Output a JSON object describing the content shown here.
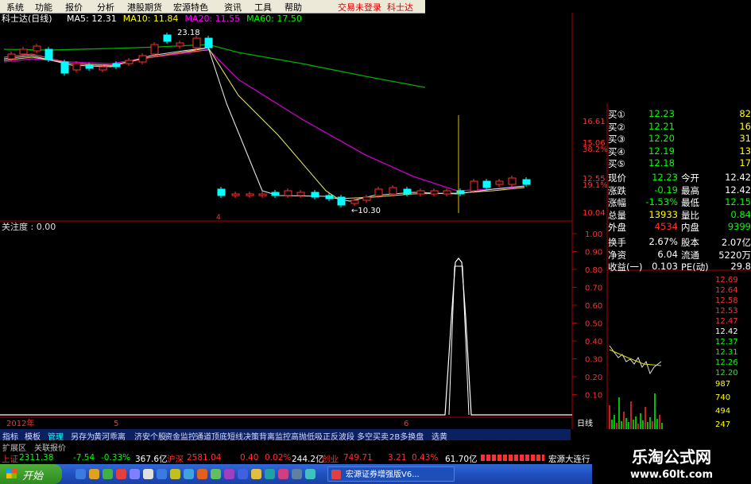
{
  "menu": {
    "items": [
      "系统",
      "功能",
      "报价",
      "分析",
      "港股期货",
      "宏源特色",
      "资讯",
      "工具",
      "帮助"
    ],
    "trade_login": "交易未登录",
    "stock_short": "科士达"
  },
  "chart": {
    "title": "科士达(日线)",
    "ma_labels": [
      {
        "text": "MA5: 12.31",
        "color": "#ffffff"
      },
      {
        "text": "MA10: 11.84",
        "color": "#ffff00"
      },
      {
        "text": "MA20: 11.55",
        "color": "#ff00ff"
      },
      {
        "text": "MA60: 17.50",
        "color": "#00ff00"
      }
    ],
    "high_label": "23.18",
    "low_label": "10.30",
    "price_axis": [
      "16.61",
      "15.06",
      "38.2%",
      "12.55",
      "19.1%",
      "10.04"
    ],
    "indicator_title": "关注度 : 0.00",
    "indicator_axis": [
      "1.00",
      "0.90",
      "0.80",
      "0.70",
      "0.60",
      "0.50",
      "0.40",
      "0.30",
      "0.20",
      "0.10"
    ],
    "time_labels": [
      "2012年",
      "5",
      "6"
    ],
    "marker_4": "4",
    "colors": {
      "up": "#ff3030",
      "down": "#00ffff",
      "ma60": "#00cc00",
      "ma20": "#cc00cc",
      "ma10": "#e0e060",
      "axis": "#b00000"
    }
  },
  "quote": {
    "book": [
      {
        "label": "买①",
        "price": "12.23",
        "vol": "82"
      },
      {
        "label": "买②",
        "price": "12.21",
        "vol": "16"
      },
      {
        "label": "买③",
        "price": "12.20",
        "vol": "31"
      },
      {
        "label": "买④",
        "price": "12.19",
        "vol": "13"
      },
      {
        "label": "买⑤",
        "price": "12.18",
        "vol": "17"
      }
    ],
    "stats": [
      {
        "l1": "现价",
        "v1": "12.23",
        "c1": "#00ff00",
        "l2": "今开",
        "v2": "12.42",
        "c2": "#ffffff"
      },
      {
        "l1": "涨跌",
        "v1": "-0.19",
        "c1": "#00ff00",
        "l2": "最高",
        "v2": "12.42",
        "c2": "#ffffff"
      },
      {
        "l1": "涨幅",
        "v1": "-1.53%",
        "c1": "#00ff00",
        "l2": "最低",
        "v2": "12.15",
        "c2": "#00ff00"
      },
      {
        "l1": "总量",
        "v1": "13933",
        "c1": "#ffff00",
        "l2": "量比",
        "v2": "0.84",
        "c2": "#00ff00"
      },
      {
        "l1": "外盘",
        "v1": "4534",
        "c1": "#ff3030",
        "l2": "内盘",
        "v2": "9399",
        "c2": "#00ff00"
      },
      {
        "l1": "换手",
        "v1": "2.67%",
        "c1": "#ffffff",
        "l2": "股本",
        "v2": "2.07亿",
        "c2": "#ffffff"
      },
      {
        "l1": "净资",
        "v1": "6.04",
        "c1": "#ffffff",
        "l2": "流通",
        "v2": "5220万",
        "c2": "#ffffff"
      },
      {
        "l1": "收益(一)",
        "v1": "0.103",
        "c1": "#ffffff",
        "l2": "PE(动)",
        "v2": "29.8",
        "c2": "#ffffff"
      }
    ],
    "mini_axis": [
      "12.69",
      "12.64",
      "12.58",
      "12.53",
      "12.47",
      "12.42",
      "12.37",
      "12.31",
      "12.26",
      "12.20"
    ],
    "mini_vol_axis": [
      "987",
      "740",
      "494",
      "247"
    ],
    "period": "日线"
  },
  "tabs": {
    "row1": [
      "指标",
      "模板",
      "管理",
      "另存为",
      "黄河乖离",
      "济安个股",
      "资金监控",
      "通道顶底",
      "短线决策",
      "背离监控",
      "高抛低吸",
      "正反波段",
      "多空买卖",
      "2B多换盘",
      "选黄"
    ],
    "row2": [
      "扩展区",
      "关联报价"
    ]
  },
  "status": {
    "sh_name": "上证",
    "sh_val": "2311.38",
    "sh_chg": "-7.54",
    "sh_pct": "-0.33%",
    "sh_amt": "367.6亿",
    "sz_name": "沪深",
    "sz_val": "2581.04",
    "sz_chg": "0.40",
    "sz_pct": "0.02%",
    "sz_amt": "244.2亿",
    "cy_name": "创业",
    "cy_val": "749.71",
    "cy_chg": "3.21",
    "cy_pct": "0.43%",
    "cy_amt": "61.70亿",
    "broker": "宏源大连行"
  },
  "taskbar": {
    "start": "开始",
    "app": "宏源证券增强版V6..."
  },
  "watermark": {
    "line1": "乐淘公式网",
    "line2": "www.60lt.com"
  }
}
